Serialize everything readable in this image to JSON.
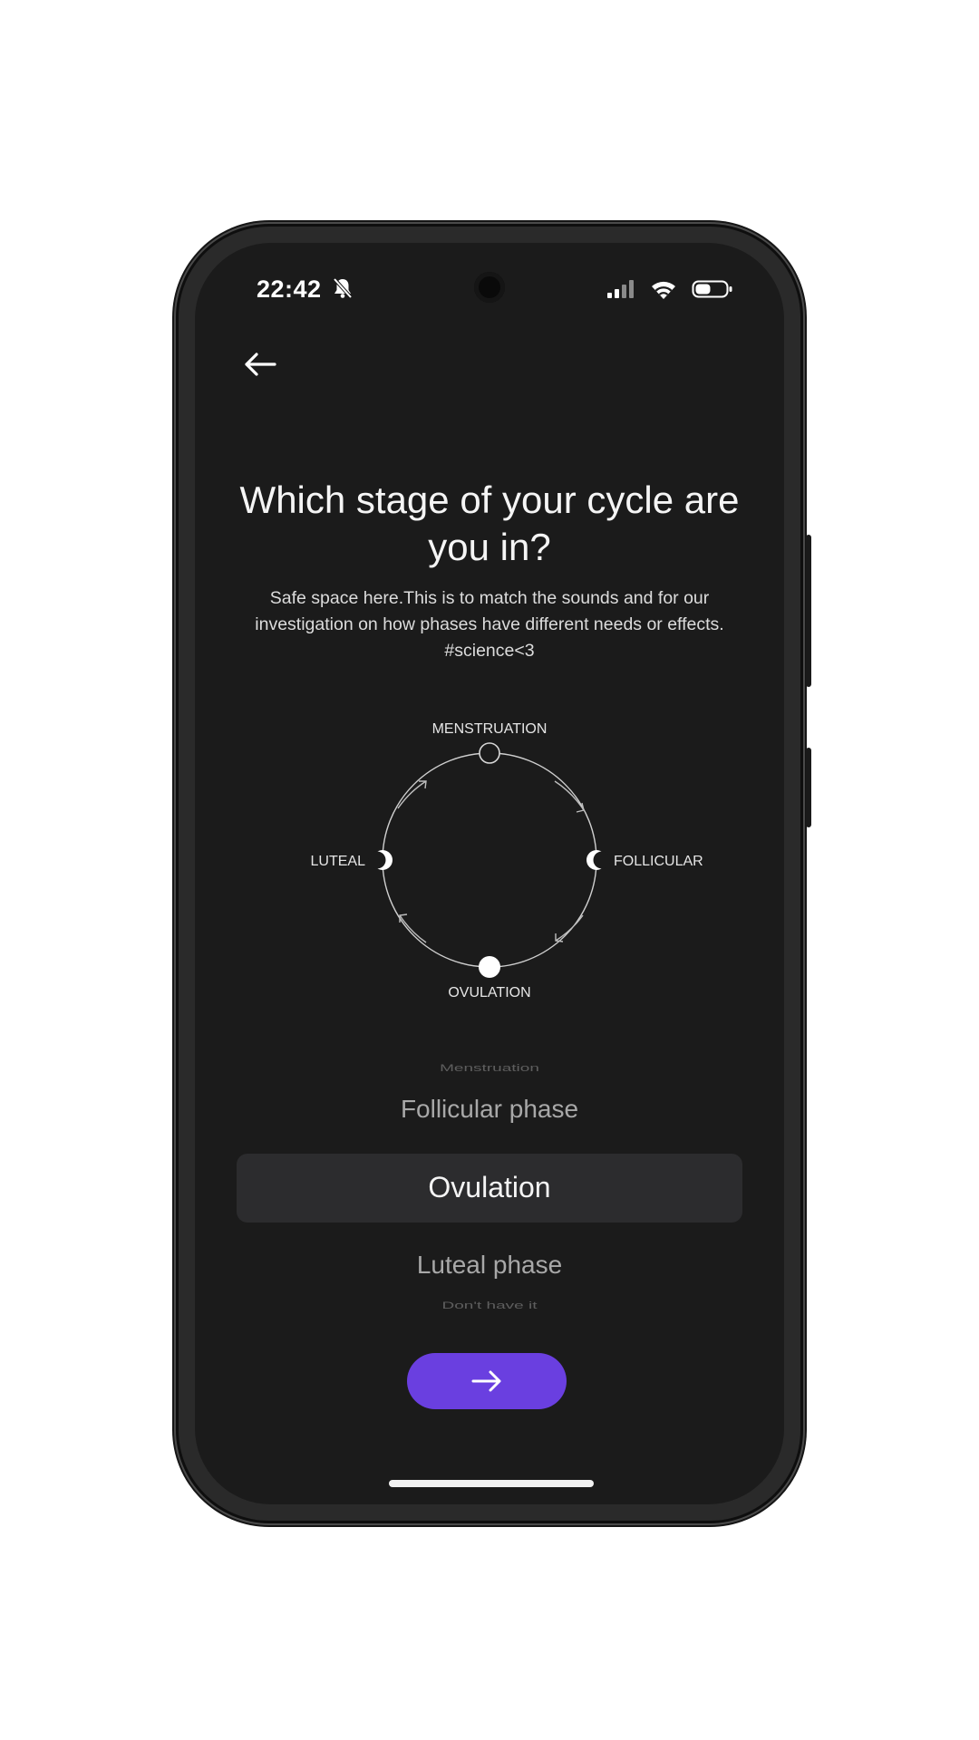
{
  "status_bar": {
    "time": "22:42",
    "icons": [
      "bell-off-icon",
      "signal-icon",
      "wifi-icon",
      "battery-icon"
    ]
  },
  "nav": {
    "back_icon": "arrow-left-icon"
  },
  "question": {
    "title": "Which stage of your cycle are you in?",
    "subtitle": "Safe space here.This is to match the sounds and for our investigation on how phases have different needs or effects. #science<3"
  },
  "cycle_diagram": {
    "top_label": "MENSTRUATION",
    "right_label": "FOLLICULAR",
    "bottom_label": "OVULATION",
    "left_label": "LUTEAL"
  },
  "picker": {
    "options": [
      "Menstruation",
      "Follicular phase",
      "Ovulation",
      "Luteal phase",
      "Don't have it"
    ],
    "selected": "Ovulation"
  },
  "next_button": {
    "icon": "arrow-right-icon"
  },
  "colors": {
    "background": "#1b1b1b",
    "accent": "#6a3fe0",
    "selection_band": "#2c2c2e"
  }
}
